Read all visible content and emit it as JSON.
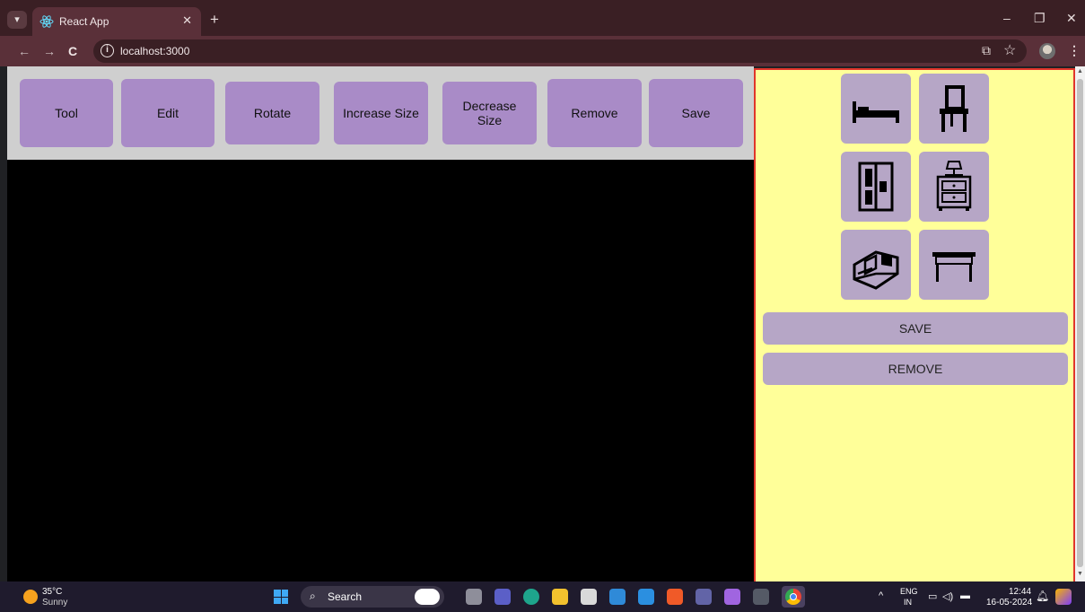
{
  "browser": {
    "tab_title": "React App",
    "tab_close": "✕",
    "new_tab": "+",
    "url": "localhost:3000",
    "info_glyph": "i",
    "window_min": "–",
    "window_restore": "❐",
    "window_close": "✕",
    "back_glyph": "←",
    "forward_glyph": "→",
    "reload_glyph": "C",
    "cast_glyph": "⧉",
    "star_glyph": "☆",
    "menu_glyph": "⋮"
  },
  "toolbar": {
    "buttons": [
      "Tool",
      "Edit",
      "Rotate",
      "Increase Size",
      "Decrease Size",
      "Remove",
      "Save"
    ]
  },
  "palette": {
    "items": [
      "bed-icon",
      "chair-icon",
      "wardrobe-icon",
      "nightstand-icon",
      "sofa-icon",
      "table-icon"
    ],
    "save_label": "SAVE",
    "remove_label": "REMOVE"
  },
  "taskbar": {
    "temperature": "35°C",
    "weather": "Sunny",
    "search_label": "Search",
    "lang_top": "ENG",
    "lang_bottom": "IN",
    "time": "12:44",
    "date": "16-05-2024"
  },
  "colors": {
    "button_purple": "#a98bc7",
    "palette_bg": "#ffff99",
    "palette_border": "#e0352b",
    "tile_bg": "#b6a6c6"
  }
}
